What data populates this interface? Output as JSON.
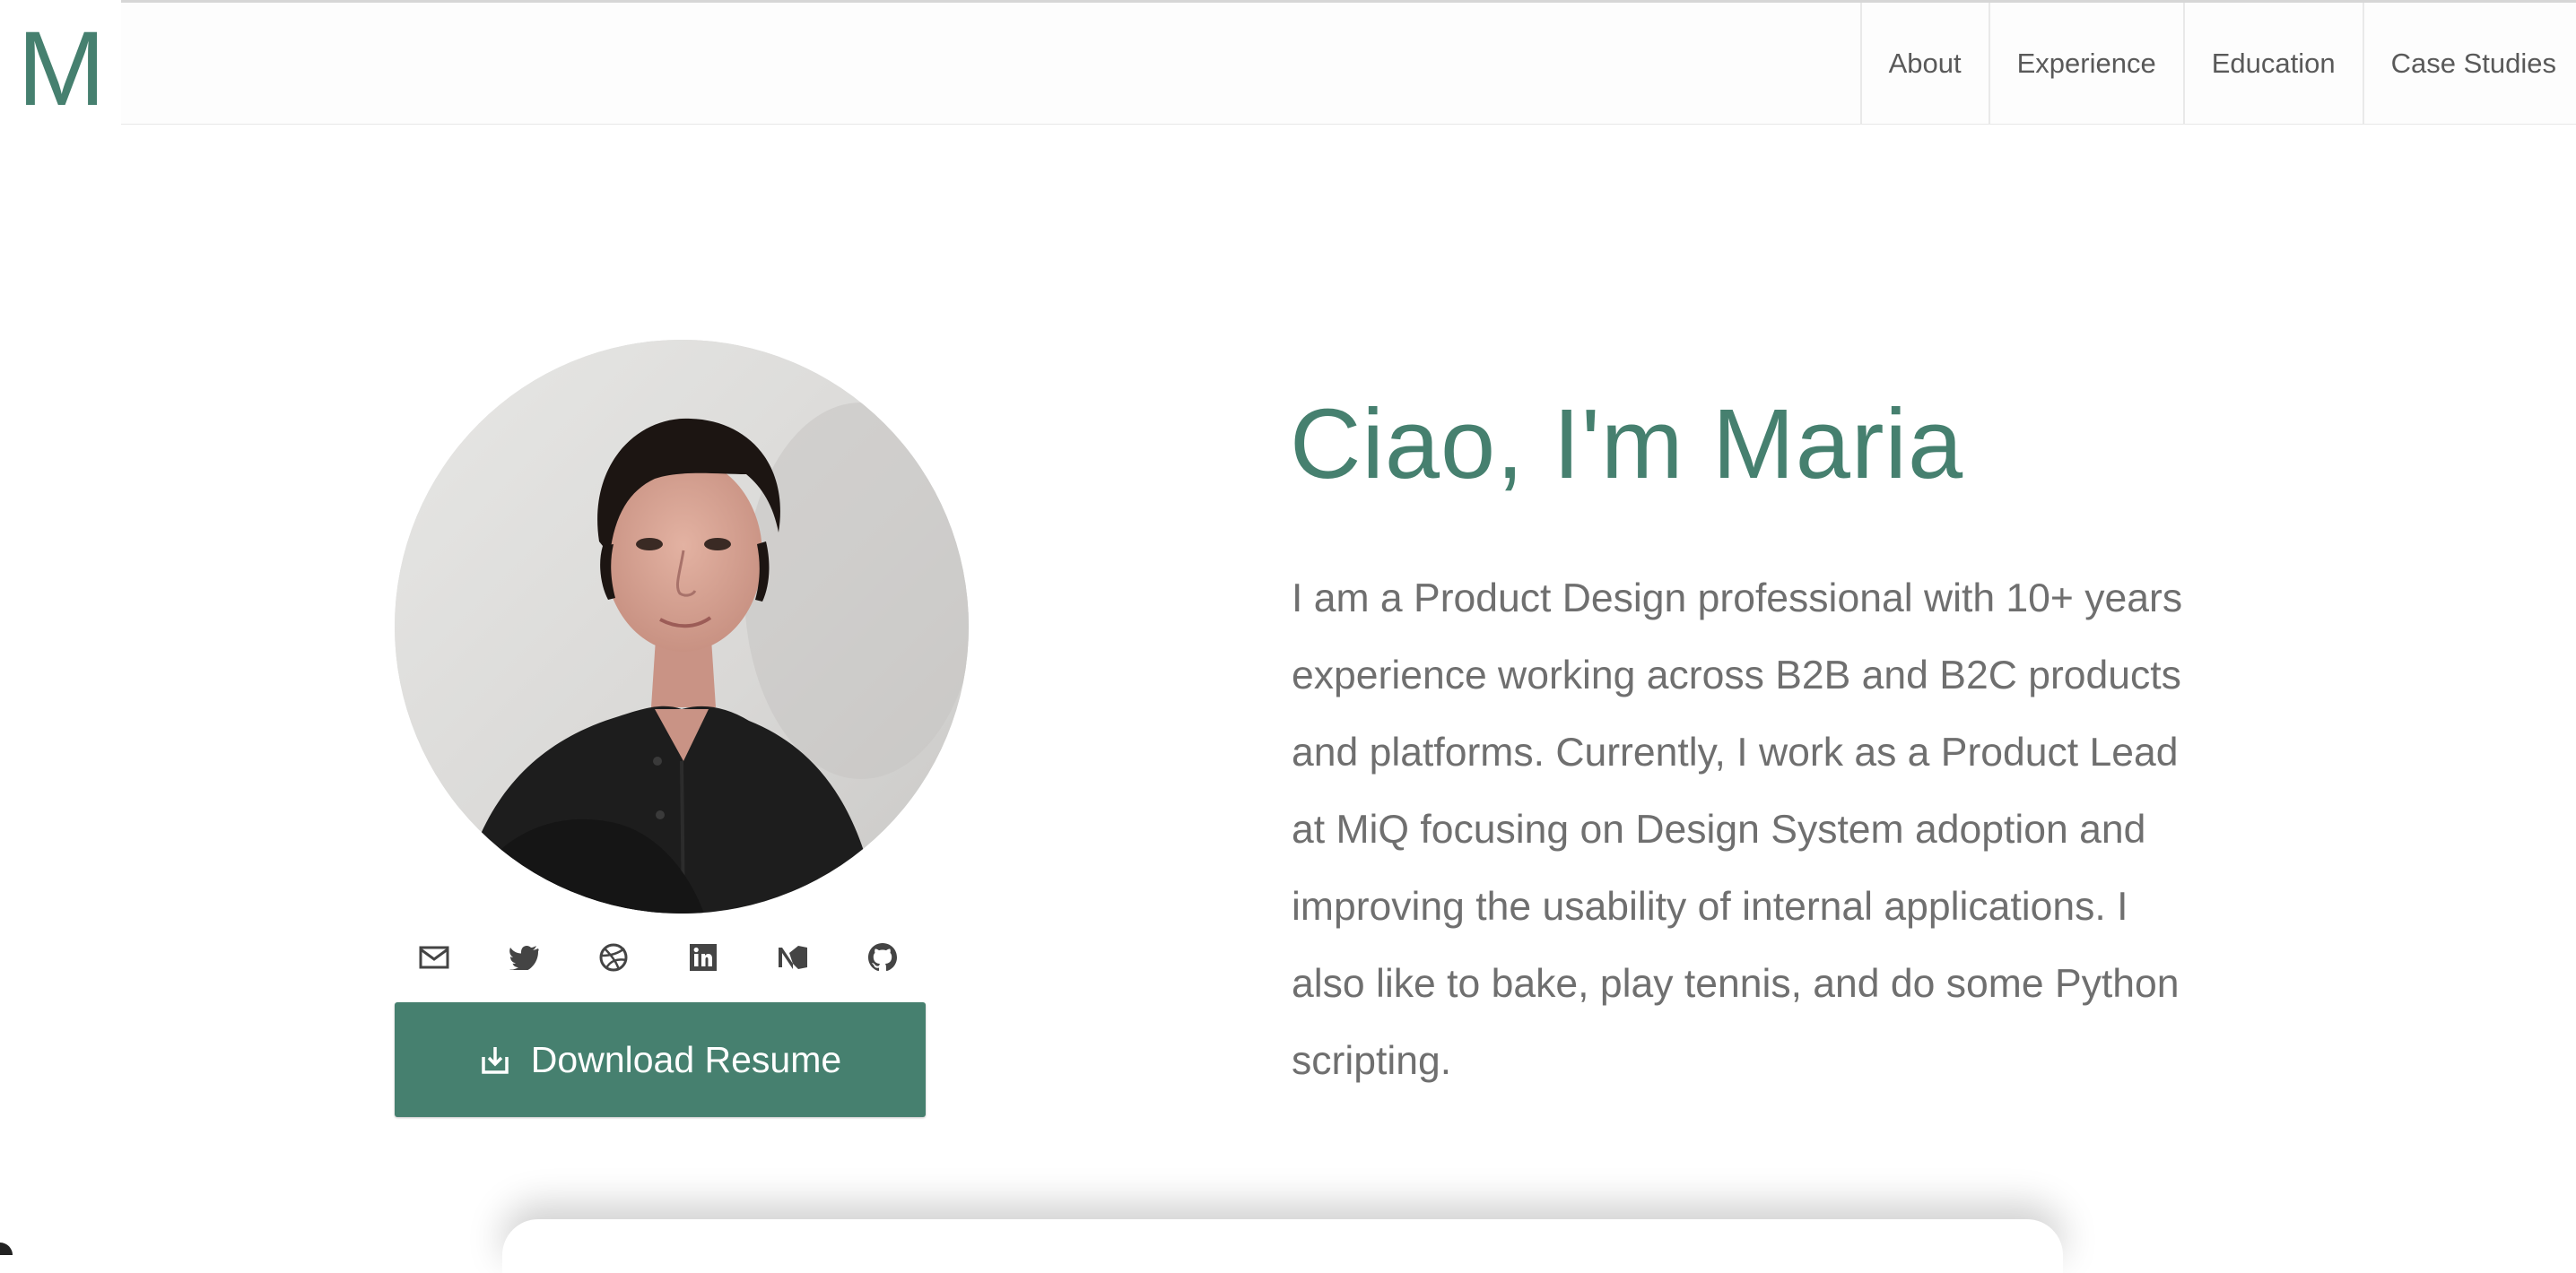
{
  "header": {
    "logo": "M",
    "nav": [
      "About",
      "Experience",
      "Education",
      "Case Studies"
    ]
  },
  "hero": {
    "title": "Ciao, I'm Maria",
    "intro": "I am a Product Design professional with 10+ years experience working across B2B and B2C products and platforms. Currently, I work as a Product Lead at MiQ focusing on Design System adoption and improving the usability of internal applications. I also like to bake, play tennis, and do some Python scripting."
  },
  "profile": {
    "photo_alt": "Portrait of Maria"
  },
  "socials": [
    "mail-icon",
    "twitter-icon",
    "dribbble-icon",
    "linkedin-icon",
    "medium-icon",
    "github-icon"
  ],
  "cta": {
    "label": "Download Resume",
    "icon": "download-icon"
  },
  "colors": {
    "accent": "#46806f",
    "text": "#6f6f6f",
    "nav_text": "#595959",
    "icon": "#444444"
  }
}
